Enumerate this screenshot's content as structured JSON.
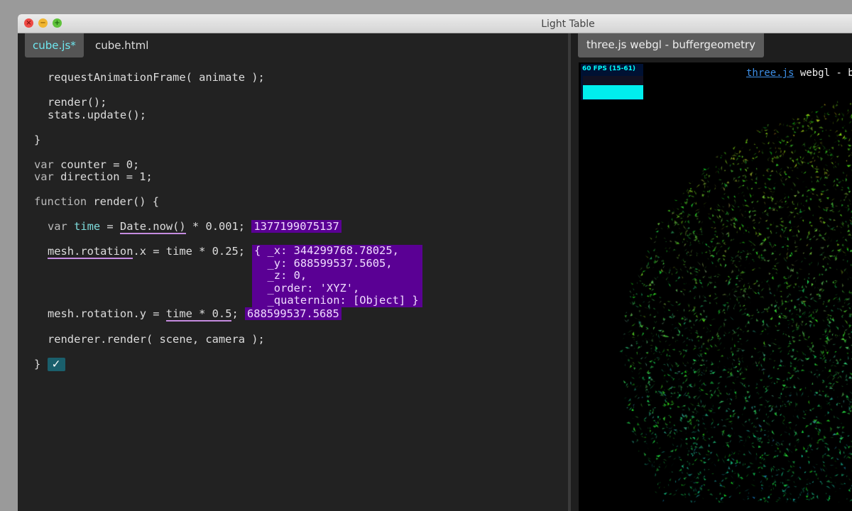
{
  "window": {
    "title": "Light Table"
  },
  "editor": {
    "tabs": [
      {
        "label": "cube.js*",
        "active": true
      },
      {
        "label": "cube.html",
        "active": false
      }
    ],
    "lines": {
      "l1": "requestAnimationFrame( animate );",
      "l2": "render();",
      "l3": "stats.update();",
      "l4": "}",
      "l5a": "var",
      "l5b": " counter = 0;",
      "l6a": "var",
      "l6b": " direction = 1;",
      "l7a": "function",
      "l7b": " render() {",
      "l8a": "var ",
      "l8b": "time",
      "l8c": " = ",
      "l8d": "Date.now()",
      "l8e": " * 0.001;",
      "l9a": "mesh.rotation",
      "l9b": ".x = time * 0.25;",
      "l10a": "mesh.rotation.y = ",
      "l10b": "time * 0.5",
      "l10c": ";",
      "l11": "renderer.render( scene, camera );",
      "l12": "}"
    },
    "results": {
      "time": "1377199075137",
      "rotation_x": "{ _x: 344299768.78025,\n  _y: 688599537.5605,\n  _z: 0,\n  _order: 'XYZ',\n  _quaternion: [Object] }",
      "rotation_y": "688599537.5685",
      "eval_ok": "✓"
    }
  },
  "preview": {
    "tab_label": "three.js webgl - buffergeometry",
    "stats": {
      "fps_text": "60 FPS (15-61)"
    },
    "info_link": "three.js",
    "info_text": " webgl - buffergeometry"
  }
}
